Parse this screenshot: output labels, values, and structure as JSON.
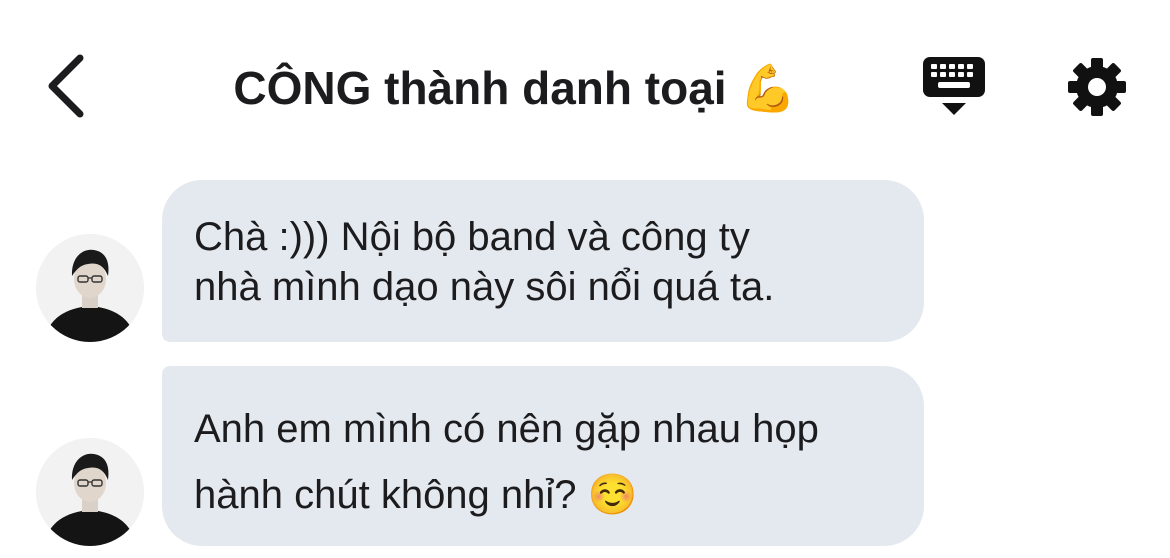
{
  "header": {
    "back_icon": "chevron-left-icon",
    "title": "CÔNG thành danh toại",
    "title_emoji": "💪",
    "keyboard_icon": "keyboard-icon",
    "settings_icon": "gear-icon"
  },
  "messages": [
    {
      "lines": [
        "Chà :))) Nội bộ band và công ty",
        "nhà mình dạo này sôi nổi quá ta."
      ],
      "bubble_color": "#e4e9ef"
    },
    {
      "lines": [
        "Anh em mình có nên gặp nhau họp",
        "hành chút không nhỉ? ☺️"
      ],
      "bubble_color": "#e4e9ef"
    }
  ],
  "colors": {
    "background": "#ffffff",
    "bubble": "#e4e9ef",
    "text": "#1c1c1e"
  }
}
